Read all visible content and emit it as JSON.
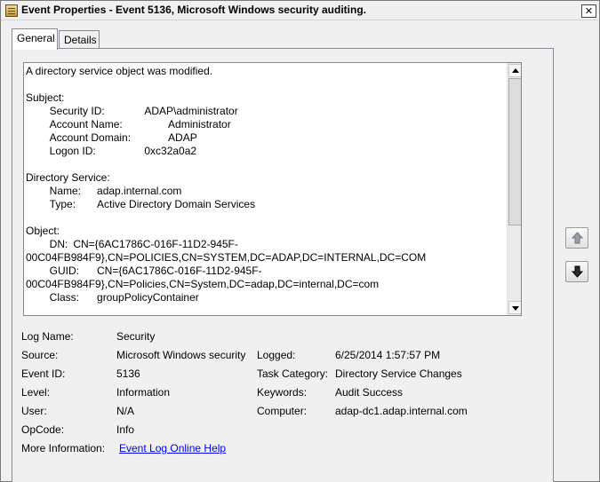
{
  "window": {
    "title": "Event Properties - Event 5136, Microsoft Windows security auditing.",
    "close_glyph": "✕"
  },
  "tabs": [
    {
      "label": "General"
    },
    {
      "label": "Details"
    }
  ],
  "description": {
    "text": "A directory service object was modified.\n\nSubject:\n\tSecurity ID:\t\tADAP\\administrator\n\tAccount Name:\t\tAdministrator\n\tAccount Domain:\t\tADAP\n\tLogon ID:\t\t0xc32a0a2\n\nDirectory Service:\n\tName:\tadap.internal.com\n\tType:\tActive Directory Domain Services\n\nObject:\n\tDN:\tCN={6AC1786C-016F-11D2-945F-\n00C04FB984F9},CN=POLICIES,CN=SYSTEM,DC=ADAP,DC=INTERNAL,DC=COM\n\tGUID:\tCN={6AC1786C-016F-11D2-945F-\n00C04FB984F9},CN=Policies,CN=System,DC=adap,DC=internal,DC=com\n\tClass:\tgroupPolicyContainer"
  },
  "details": {
    "log_name_label": "Log Name:",
    "log_name_value": "Security",
    "source_label": "Source:",
    "source_value": "Microsoft Windows security",
    "logged_label": "Logged:",
    "logged_value": "6/25/2014 1:57:57 PM",
    "event_id_label": "Event ID:",
    "event_id_value": "5136",
    "task_category_label": "Task Category:",
    "task_category_value": "Directory Service Changes",
    "level_label": "Level:",
    "level_value": "Information",
    "keywords_label": "Keywords:",
    "keywords_value": "Audit Success",
    "user_label": "User:",
    "user_value": "N/A",
    "computer_label": "Computer:",
    "computer_value": "adap-dc1.adap.internal.com",
    "opcode_label": "OpCode:",
    "opcode_value": "Info",
    "more_info_label": "More Information:",
    "more_info_link": "Event Log Online Help"
  },
  "icons": {
    "title_icon": "event-viewer-icon",
    "nav_up": "up-arrow-icon",
    "nav_down": "down-arrow-icon"
  }
}
